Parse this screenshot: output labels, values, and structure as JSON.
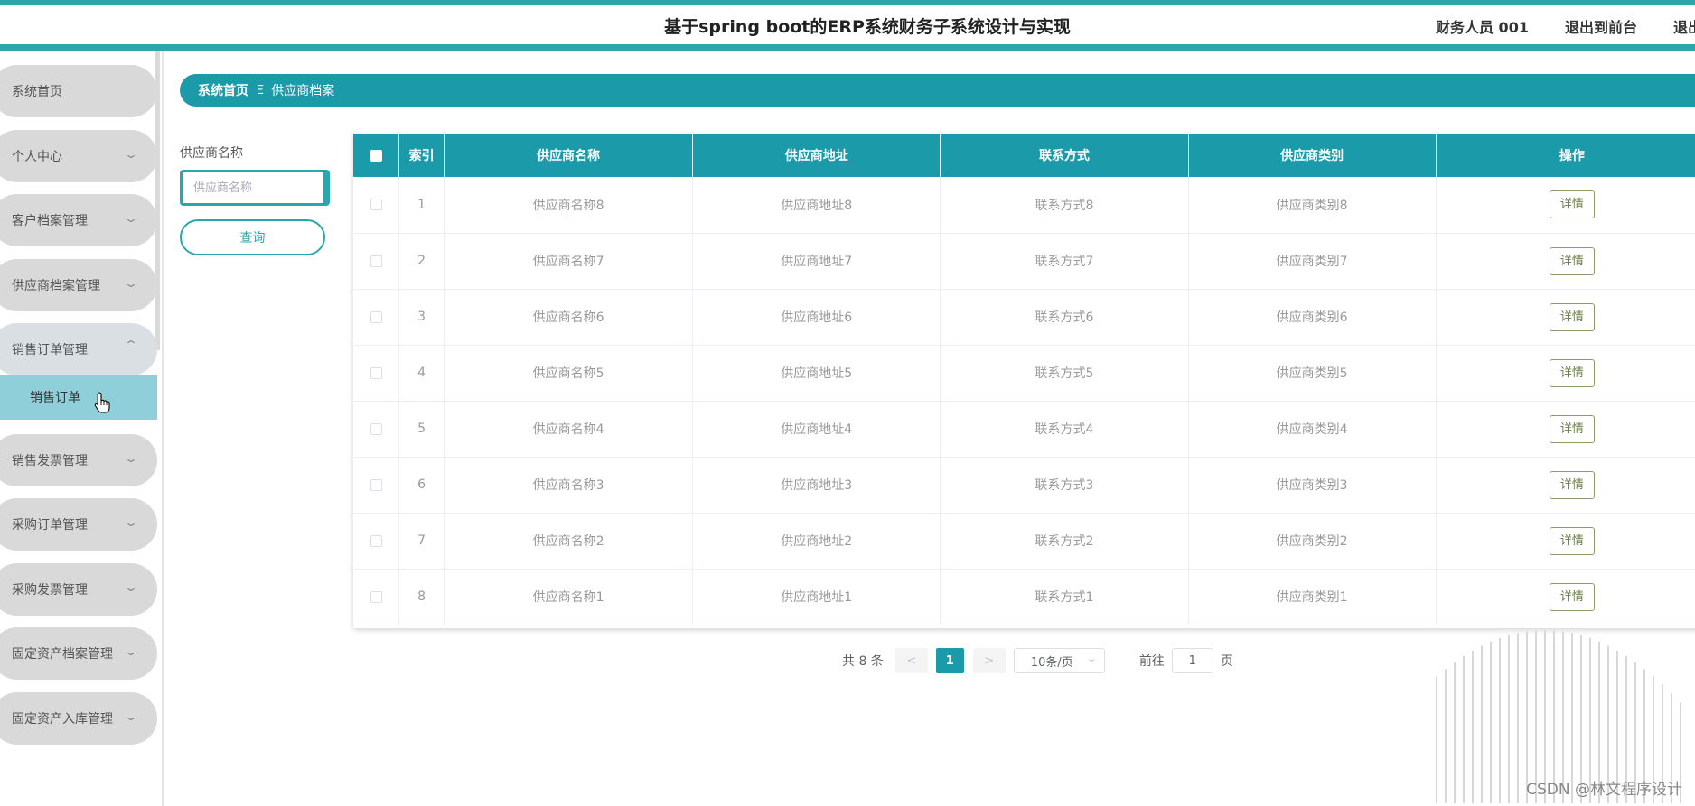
{
  "header": {
    "title": "基于spring boot的ERP系统财务子系统设计与实现",
    "user": "财务人员 001",
    "back_to_front": "退出到前台",
    "logout": "退出登录"
  },
  "sidebar": {
    "items": [
      {
        "label": "系统首页"
      },
      {
        "label": "个人中心"
      },
      {
        "label": "客户档案管理"
      },
      {
        "label": "供应商档案管理"
      },
      {
        "label": "销售订单管理"
      },
      {
        "label": "销售发票管理"
      },
      {
        "label": "采购订单管理"
      },
      {
        "label": "采购发票管理"
      },
      {
        "label": "固定资产档案管理"
      },
      {
        "label": "固定资产入库管理"
      }
    ],
    "submenu_item": "销售订单"
  },
  "breadcrumb": {
    "home": "系统首页",
    "separator": "Ξ",
    "current": "供应商档案"
  },
  "search": {
    "label": "供应商名称",
    "placeholder": "供应商名称",
    "button": "查询"
  },
  "table": {
    "headers": [
      "索引",
      "供应商名称",
      "供应商地址",
      "联系方式",
      "供应商类别",
      "操作"
    ],
    "rows": [
      {
        "index": "1",
        "name": "供应商名称8",
        "address": "供应商地址8",
        "contact": "联系方式8",
        "category": "供应商类别8",
        "action": "详情"
      },
      {
        "index": "2",
        "name": "供应商名称7",
        "address": "供应商地址7",
        "contact": "联系方式7",
        "category": "供应商类别7",
        "action": "详情"
      },
      {
        "index": "3",
        "name": "供应商名称6",
        "address": "供应商地址6",
        "contact": "联系方式6",
        "category": "供应商类别6",
        "action": "详情"
      },
      {
        "index": "4",
        "name": "供应商名称5",
        "address": "供应商地址5",
        "contact": "联系方式5",
        "category": "供应商类别5",
        "action": "详情"
      },
      {
        "index": "5",
        "name": "供应商名称4",
        "address": "供应商地址4",
        "contact": "联系方式4",
        "category": "供应商类别4",
        "action": "详情"
      },
      {
        "index": "6",
        "name": "供应商名称3",
        "address": "供应商地址3",
        "contact": "联系方式3",
        "category": "供应商类别3",
        "action": "详情"
      },
      {
        "index": "7",
        "name": "供应商名称2",
        "address": "供应商地址2",
        "contact": "联系方式2",
        "category": "供应商类别2",
        "action": "详情"
      },
      {
        "index": "8",
        "name": "供应商名称1",
        "address": "供应商地址1",
        "contact": "联系方式1",
        "category": "供应商类别1",
        "action": "详情"
      }
    ]
  },
  "pagination": {
    "total": "共 8 条",
    "prev": "<",
    "current_page": "1",
    "next": ">",
    "page_size": "10条/页",
    "goto_label": "前往",
    "goto_value": "1",
    "page_suffix": "页"
  },
  "watermark": "CSDN @林文程序设计",
  "colors": {
    "accent": "#1b9aaa",
    "accent_light": "#2aa7ad",
    "submenu_bg": "#8fcfd9",
    "menu_bg": "#d9d9d9"
  },
  "icons": {
    "chevron_down": "chevron-down-icon",
    "chevron_up": "chevron-up-icon",
    "pointer": "hand-pointer-icon"
  }
}
